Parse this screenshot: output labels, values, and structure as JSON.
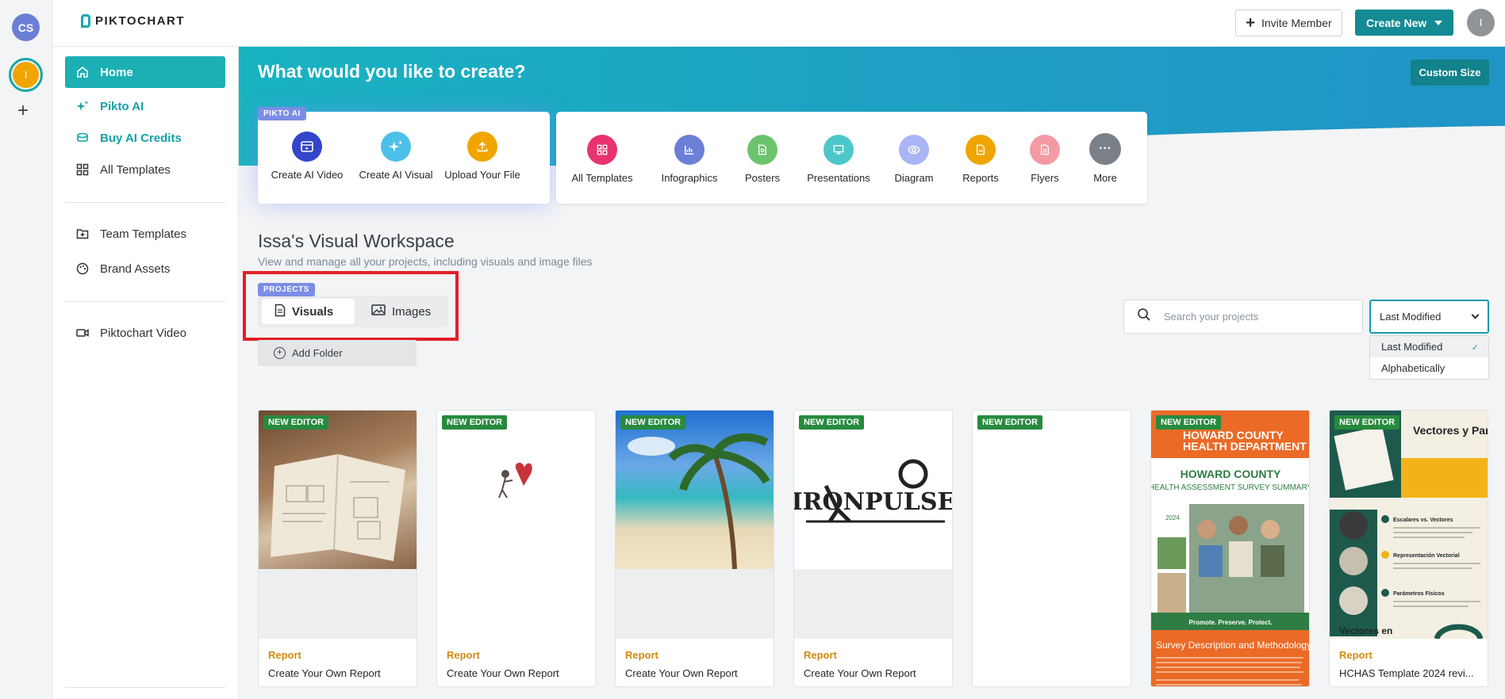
{
  "rail": {
    "workspace_initials": "CS",
    "user_initial": "I",
    "add_label": "+"
  },
  "topbar": {
    "brand": "PIKTOCHART",
    "invite_label": "Invite Member",
    "create_new_label": "Create New",
    "avatar_initial": "I"
  },
  "sidebar": {
    "items": [
      {
        "label": "Home",
        "icon": "home-icon"
      },
      {
        "label": "Pikto AI",
        "icon": "sparkle-icon"
      },
      {
        "label": "Buy AI Credits",
        "icon": "coins-icon"
      },
      {
        "label": "All Templates",
        "icon": "grid-icon"
      },
      {
        "label": "Team Templates",
        "icon": "folder-plus-icon"
      },
      {
        "label": "Brand Assets",
        "icon": "palette-icon"
      },
      {
        "label": "Piktochart Video",
        "icon": "video-icon"
      }
    ]
  },
  "hero": {
    "title": "What would you like to create?",
    "custom_size_label": "Custom Size"
  },
  "ai_panel": {
    "badge": "PIKTO AI",
    "items": [
      {
        "label": "Create AI Video",
        "icon": "video-icon",
        "color": "#3345c9"
      },
      {
        "label": "Create AI Visual",
        "icon": "sparkle-icon",
        "color": "#4cc0e8"
      },
      {
        "label": "Upload Your File",
        "icon": "upload-icon",
        "color": "#f0a500"
      }
    ]
  },
  "types": [
    {
      "label": "All Templates",
      "icon": "grid-icon",
      "color": "#e8336f"
    },
    {
      "label": "Infographics",
      "icon": "chart-icon",
      "color": "#6c7fd6"
    },
    {
      "label": "Posters",
      "icon": "poster-icon",
      "color": "#6bc46d"
    },
    {
      "label": "Presentations",
      "icon": "presentation-icon",
      "color": "#4dc7c9"
    },
    {
      "label": "Diagram",
      "icon": "diagram-icon",
      "color": "#aab5f5"
    },
    {
      "label": "Reports",
      "icon": "report-icon",
      "color": "#f0a500"
    },
    {
      "label": "Flyers",
      "icon": "flyer-icon",
      "color": "#f59aa4"
    },
    {
      "label": "More",
      "icon": "more-icon",
      "color": "#7a8087"
    }
  ],
  "workspace": {
    "title": "Issa's Visual Workspace",
    "subtitle": "View and manage all your projects, including visuals and image files"
  },
  "projects": {
    "badge": "PROJECTS",
    "tabs": [
      "Visuals",
      "Images"
    ],
    "add_folder_label": "Add Folder"
  },
  "search": {
    "placeholder": "Search your projects"
  },
  "sort": {
    "selected": "Last Modified",
    "options": [
      "Last Modified",
      "Alphabetically"
    ]
  },
  "cards": [
    {
      "badge": "NEW EDITOR",
      "category": "Report",
      "name": "Create Your Own Report",
      "thumb": "notebook-photo"
    },
    {
      "badge": "NEW EDITOR",
      "category": "Report",
      "name": "Create Your Own Report",
      "thumb": "heart-illustration"
    },
    {
      "badge": "NEW EDITOR",
      "category": "Report",
      "name": "Create Your Own Report",
      "thumb": "beach-photo"
    },
    {
      "badge": "NEW EDITOR",
      "category": "Report",
      "name": "Create Your Own Report",
      "thumb": "ironpulse-logo"
    },
    {
      "badge": "NEW EDITOR",
      "category": "",
      "name": "",
      "thumb": "blank"
    },
    {
      "badge": "NEW EDITOR",
      "category": "",
      "name": "",
      "thumb": "howard-county-report"
    },
    {
      "badge": "NEW EDITOR",
      "category": "Report",
      "name": "HCHAS Template 2024 revi...",
      "thumb": "vectores-parametros"
    }
  ],
  "thumb_text": {
    "ironpulse": "IRONPULSE",
    "hc_dept_1": "HOWARD COUNTY",
    "hc_dept_2": "HEALTH DEPARTMENT",
    "hc_title_1": "HOWARD COUNTY",
    "hc_title_2": "HEALTH ASSESSMENT SURVEY SUMMARY",
    "hc_year": "2024",
    "hc_tagline": "Promote. Preserve. Protect.",
    "hc_section": "Survey Description and Methodology",
    "vp_title": "Vectores y Parámetros",
    "vp_item1": "Escalares vs. Vectores",
    "vp_item2": "Representación Vectorial",
    "vp_item3": "Parámetros Físicos",
    "vp_footer": "Vectores en"
  }
}
